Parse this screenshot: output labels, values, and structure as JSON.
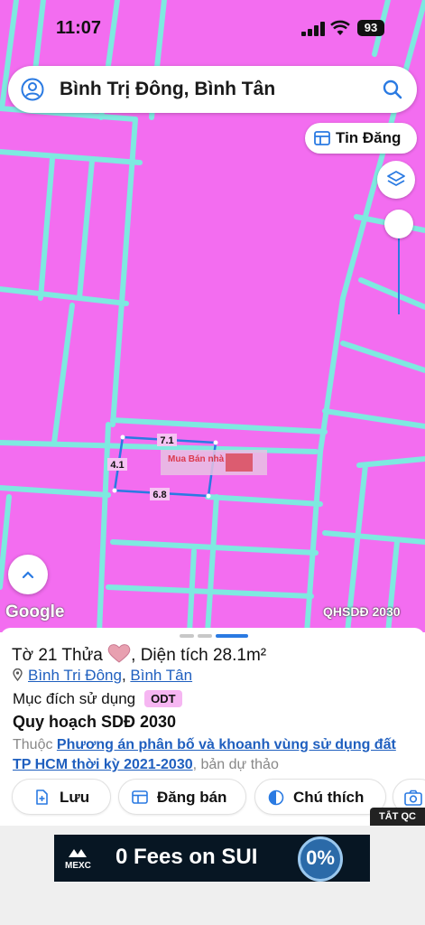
{
  "status_bar": {
    "time": "11:07",
    "battery": "93"
  },
  "search": {
    "text": "Bình Trị Đông, Bình Tân"
  },
  "tin_dang": {
    "label": "Tin Đăng"
  },
  "map": {
    "measurements": {
      "top": "7.1",
      "left": "4.1",
      "bottom": "6.8"
    },
    "watermark": "Mua Bán nhà",
    "google_logo": "Google",
    "layer_label": "QHSDĐ 2030",
    "zoom_level": 0.0
  },
  "parcel": {
    "prefix": "Tờ 21 Thửa",
    "area": ", Diện tích 28.1m²",
    "ward": "Bình Tri Đông",
    "separator": ", ",
    "district": "Bình Tân",
    "usage_label": "Mục đích sử dụng",
    "usage_code": "ODT",
    "plan_title": "Quy hoạch SDĐ 2030",
    "plan_prefix": "Thuộc ",
    "plan_link": "Phương án phân bố và khoanh vùng sử dụng đất TP HCM thời kỳ 2021-2030",
    "plan_suffix": ", bản dự thảo"
  },
  "actions": {
    "save": "Lưu",
    "post_sale": "Đăng bán",
    "legend": "Chú thích"
  },
  "ad": {
    "close_label": "TẮT QC",
    "brand": "MEXC",
    "text": "0 Fees on SUI",
    "coin_text": "0%"
  },
  "colors": {
    "map_fill": "#f36df0",
    "road": "#7ee9e0",
    "link": "#1f5fbf",
    "accent_blue": "#2a7ae2",
    "odt_bg": "#f6b6f2"
  }
}
